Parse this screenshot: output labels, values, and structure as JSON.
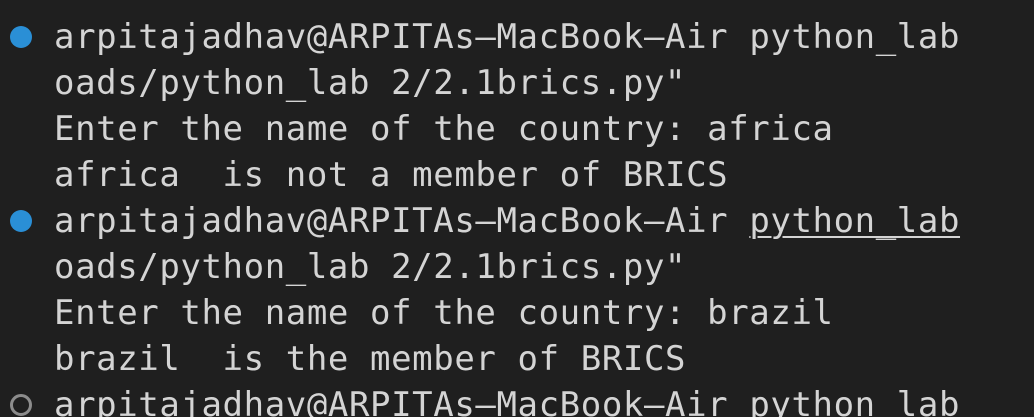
{
  "terminal": {
    "entries": [
      {
        "status": "success",
        "prompt_user": "arpitajadhav@ARPITAs—MacBook—Air ",
        "prompt_dir": "python_lab",
        "command_cont": "oads/python_lab 2/2.1brics.py\"",
        "input_prompt": "Enter the name of the country: africa",
        "output": "africa  is not a member of BRICS"
      },
      {
        "status": "success",
        "prompt_user": "arpitajadhav@ARPITAs—MacBook—Air ",
        "prompt_dir": "python_lab",
        "command_cont": "oads/python_lab 2/2.1brics.py\"",
        "input_prompt": "Enter the name of the country: brazil",
        "output": "brazil  is the member of BRICS"
      },
      {
        "status": "pending",
        "prompt_user": "arpitajadhav@ARPITAs—MacBook—Air ",
        "prompt_dir": "python_lab"
      }
    ]
  },
  "colors": {
    "background": "#1f1f1f",
    "text": "#d4d4d4",
    "success_marker": "#2a8fd6",
    "pending_marker": "#8c8c8c"
  }
}
